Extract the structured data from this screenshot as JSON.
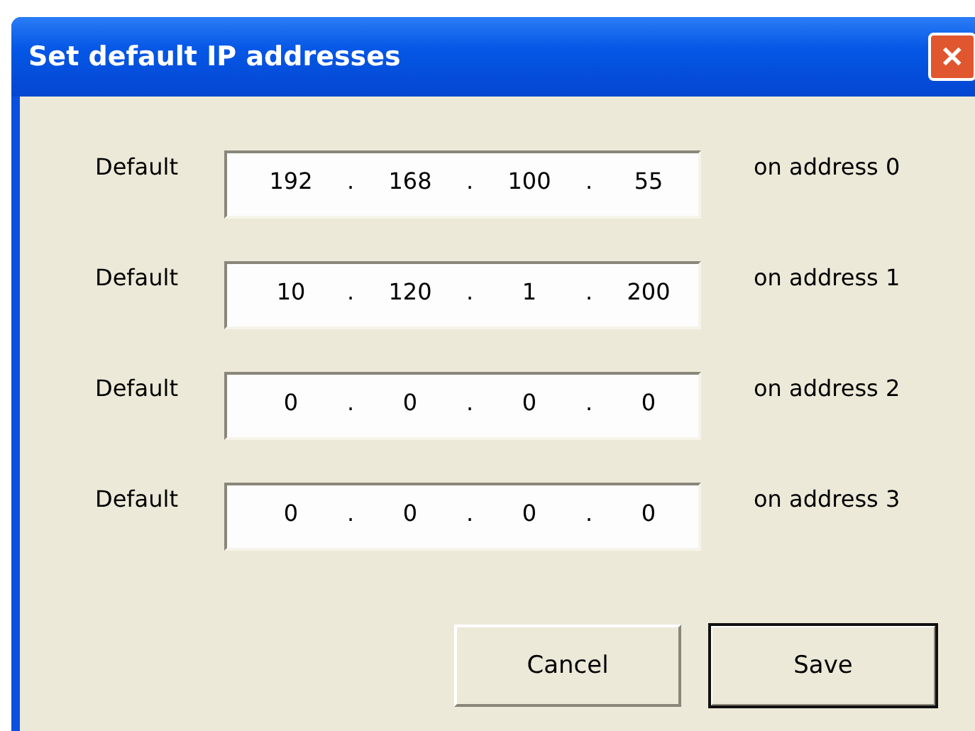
{
  "window": {
    "title": "Set default IP addresses",
    "close": "✕"
  },
  "rows": [
    {
      "label": "Default",
      "octets": [
        "192",
        "168",
        "100",
        "55"
      ],
      "separator": ".",
      "suffix": "on address 0"
    },
    {
      "label": "Default",
      "octets": [
        "10",
        "120",
        "1",
        "200"
      ],
      "separator": ".",
      "suffix": "on address 1"
    },
    {
      "label": "Default",
      "octets": [
        "0",
        "0",
        "0",
        "0"
      ],
      "separator": ".",
      "suffix": "on address 2"
    },
    {
      "label": "Default",
      "octets": [
        "0",
        "0",
        "0",
        "0"
      ],
      "separator": ".",
      "suffix": "on address 3"
    }
  ],
  "buttons": [
    {
      "label": "Cancel",
      "default": false
    },
    {
      "label": "Save",
      "default": true
    }
  ]
}
